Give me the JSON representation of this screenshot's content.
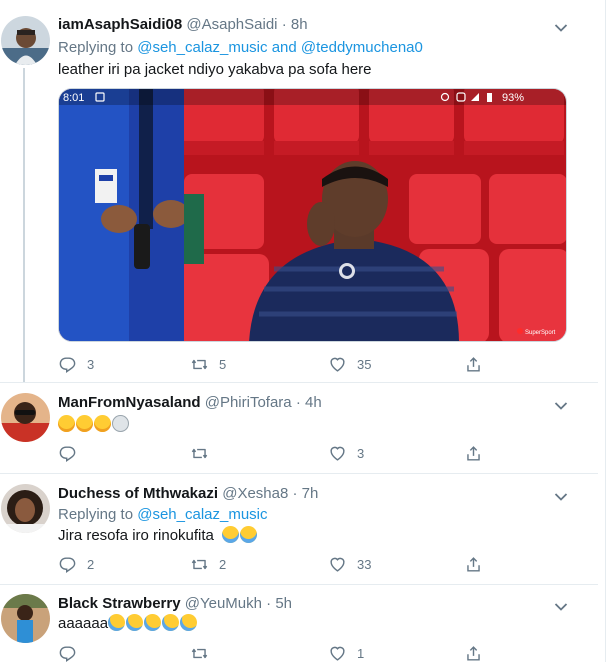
{
  "tweets": [
    {
      "name": "iamAsaphSaidi08",
      "handle": "@AsaphSaidi",
      "dot": "·",
      "time": "8h",
      "replying_prefix": "Replying to",
      "replying_user1": "@seh_calaz_music",
      "replying_and": "and",
      "replying_user2": "@teddymuchena0",
      "text": "leather iri pa jacket ndiyo yakabva pa sofa here",
      "media": {
        "status_time": "8:01",
        "battery": "93%",
        "brand_label": "SuperSport"
      },
      "replies": "3",
      "retweets": "5",
      "likes": "35"
    },
    {
      "name": "ManFromNyasaland",
      "handle": "@PhiriTofara",
      "dot": "·",
      "time": "4h",
      "emojis": [
        "sweat-smile",
        "sweat-smile",
        "sweat-smile",
        "skull"
      ],
      "replies": "",
      "retweets": "",
      "likes": "3"
    },
    {
      "name": "Duchess of Mthwakazi",
      "handle": "@Xesha8",
      "dot": "·",
      "time": "7h",
      "replying_prefix": "Replying to",
      "replying_user1": "@seh_calaz_music",
      "text": "Jira resofa iro rinokufita",
      "emojis": [
        "joy",
        "joy"
      ],
      "replies": "2",
      "retweets": "2",
      "likes": "33"
    },
    {
      "name": "Black Strawberry",
      "handle": "@YeuMukh",
      "dot": "·",
      "time": "5h",
      "text": "aaaaaa",
      "emojis": [
        "rofl",
        "rofl",
        "rofl",
        "rofl",
        "rofl"
      ],
      "replies": "",
      "retweets": "",
      "likes": "1"
    }
  ],
  "colors": {
    "text": "#14171a",
    "muted": "#657786",
    "link": "#1b95e0",
    "divider": "#e6ecf0",
    "seat_red": "#d8232f",
    "kit_blue": "#1e40a8"
  }
}
